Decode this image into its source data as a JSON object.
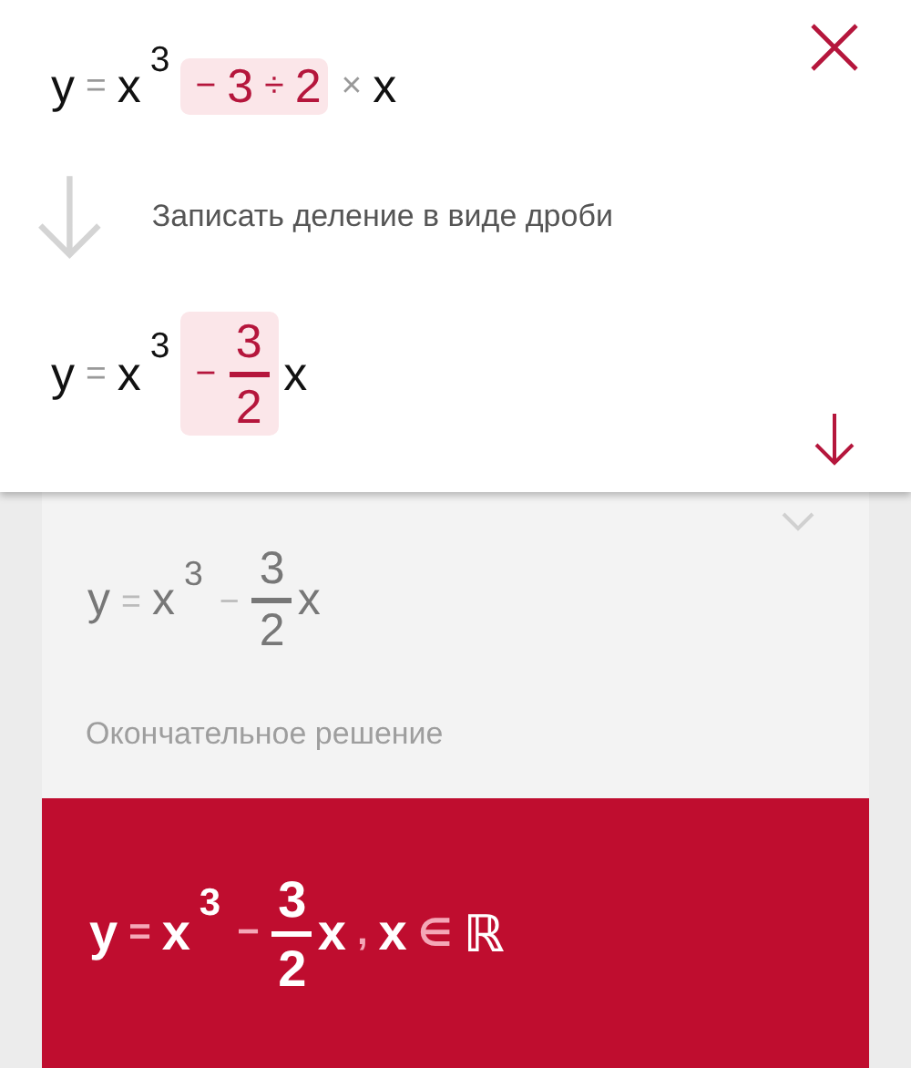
{
  "step_card": {
    "before": [
      {
        "kind": "var",
        "text": "y"
      },
      {
        "kind": "op",
        "text": "="
      },
      {
        "kind": "var",
        "text": "x"
      },
      {
        "kind": "sup",
        "text": "3"
      },
      {
        "kind": "group",
        "highlighted": true,
        "items": [
          {
            "kind": "op",
            "text": "−"
          },
          {
            "kind": "num",
            "text": "3"
          },
          {
            "kind": "op",
            "text": "÷"
          },
          {
            "kind": "num",
            "text": "2"
          }
        ]
      },
      {
        "kind": "op",
        "text": "×"
      },
      {
        "kind": "var",
        "text": "x"
      }
    ],
    "description": "Записать деление в виде дроби",
    "after": [
      {
        "kind": "var",
        "text": "y"
      },
      {
        "kind": "op",
        "text": "="
      },
      {
        "kind": "var",
        "text": "x"
      },
      {
        "kind": "sup",
        "text": "3"
      },
      {
        "kind": "group",
        "highlighted": true,
        "items": [
          {
            "kind": "op",
            "text": "−"
          },
          {
            "kind": "frac",
            "num": "3",
            "den": "2"
          }
        ]
      },
      {
        "kind": "var",
        "text": "x"
      }
    ]
  },
  "result_card": {
    "expression": [
      {
        "kind": "var",
        "text": "y"
      },
      {
        "kind": "op",
        "text": "="
      },
      {
        "kind": "var",
        "text": "x"
      },
      {
        "kind": "sup",
        "text": "3"
      },
      {
        "kind": "op",
        "text": "−"
      },
      {
        "kind": "frac",
        "num": "3",
        "den": "2"
      },
      {
        "kind": "var",
        "text": "x"
      }
    ],
    "caption": "Окончательное решение"
  },
  "answer": {
    "expression": [
      {
        "kind": "var",
        "text": "y"
      },
      {
        "kind": "op",
        "text": "="
      },
      {
        "kind": "var",
        "text": "x"
      },
      {
        "kind": "sup",
        "text": "3"
      },
      {
        "kind": "op",
        "text": "−"
      },
      {
        "kind": "frac",
        "num": "3",
        "den": "2"
      },
      {
        "kind": "var",
        "text": "x"
      },
      {
        "kind": "op",
        "text": ","
      },
      {
        "kind": "var",
        "text": "x"
      },
      {
        "kind": "op",
        "text": "∈"
      },
      {
        "kind": "var",
        "text": "ℝ"
      }
    ]
  }
}
